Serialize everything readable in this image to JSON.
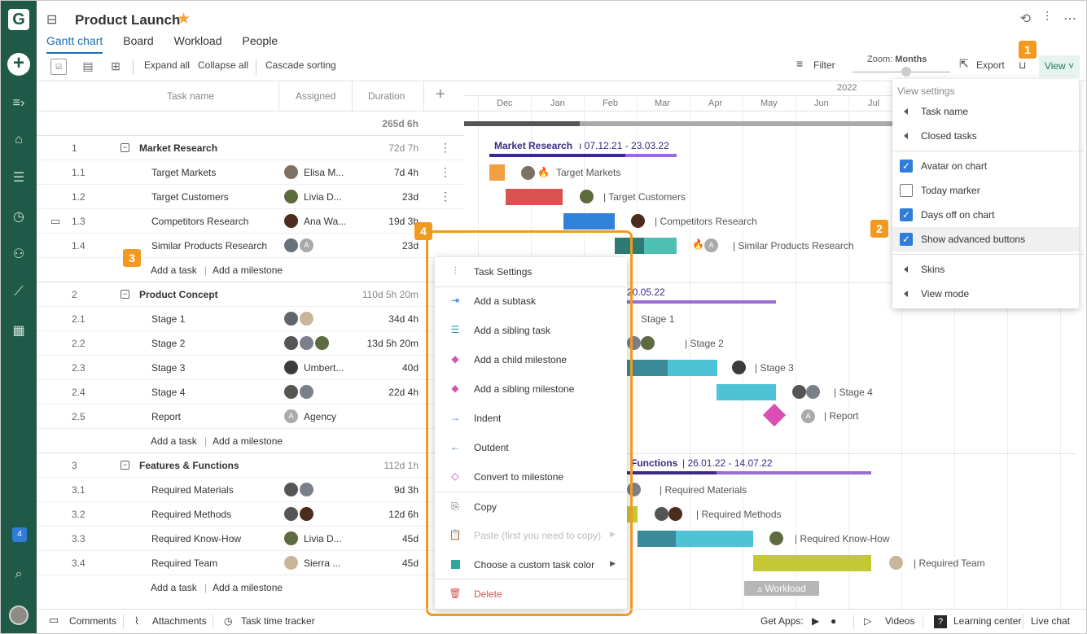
{
  "app": {
    "logo_letter": "G",
    "rail_notification_count": "4"
  },
  "header": {
    "title": "Product Launch",
    "tabs": [
      {
        "label": "Gantt chart"
      },
      {
        "label": "Board"
      },
      {
        "label": "Workload"
      },
      {
        "label": "People"
      }
    ]
  },
  "toolbar": {
    "expand_all": "Expand all",
    "collapse_all": "Collapse all",
    "cascade_sorting": "Cascade sorting",
    "filter": "Filter",
    "zoom_label": "Zoom:",
    "zoom_value": "Months",
    "export": "Export",
    "view": "View"
  },
  "grid": {
    "headers": {
      "task_name": "Task name",
      "assigned": "Assigned",
      "duration": "Duration"
    },
    "total_duration": "265d 6h",
    "rows": [
      {
        "num": "1",
        "name": "Market Research",
        "dur": "72d 7h",
        "group": true
      },
      {
        "num": "1.1",
        "name": "Target Markets",
        "assigned": "Elisa M...",
        "dur": "7d 4h"
      },
      {
        "num": "1.2",
        "name": "Target Customers",
        "assigned": "Livia D...",
        "dur": "23d"
      },
      {
        "num": "1.3",
        "name": "Competitors Research",
        "assigned": "Ana Wa...",
        "dur": "19d 3h"
      },
      {
        "num": "1.4",
        "name": "Similar Products Research",
        "assigned": "",
        "dur": "23d"
      },
      {
        "num": "2",
        "name": "Product Concept",
        "dur": "110d 5h 20m",
        "group": true
      },
      {
        "num": "2.1",
        "name": "Stage 1",
        "dur": "34d 4h"
      },
      {
        "num": "2.2",
        "name": "Stage 2",
        "dur": "13d 5h 20m"
      },
      {
        "num": "2.3",
        "name": "Stage 3",
        "assigned": "Umbert...",
        "dur": "40d"
      },
      {
        "num": "2.4",
        "name": "Stage 4",
        "dur": "22d 4h"
      },
      {
        "num": "2.5",
        "name": "Report",
        "assigned": "Agency",
        "dur": ""
      },
      {
        "num": "3",
        "name": "Features & Functions",
        "dur": "112d 1h",
        "group": true
      },
      {
        "num": "3.1",
        "name": "Required Materials",
        "dur": "9d 3h"
      },
      {
        "num": "3.2",
        "name": "Required Methods",
        "dur": "12d 6h"
      },
      {
        "num": "3.3",
        "name": "Required Know-How",
        "assigned": "Livia D...",
        "dur": "45d"
      },
      {
        "num": "3.4",
        "name": "Required Team",
        "assigned": "Sierra ...",
        "dur": "45d"
      }
    ],
    "add_task": "Add a task",
    "add_milestone": "Add a milestone",
    "avatar_initial": "A"
  },
  "chart": {
    "year": "2022",
    "months": [
      "Dec",
      "Jan",
      "Feb",
      "Mar",
      "Apr",
      "May",
      "Jun",
      "Jul"
    ],
    "group1_title": "Market Research",
    "group1_dates": "07.12.21 - 23.03.22",
    "group2_dates": "20.05.22",
    "group3_title": "Functions",
    "group3_dates": "26.01.22 - 14.07.22",
    "labels": [
      "Target Markets",
      "Target Customers",
      "Competitors Research",
      "Similar Products Research",
      "Stage 1",
      "Stage 2",
      "Stage 3",
      "Stage 4",
      "Report",
      "Required Materials",
      "Required Methods",
      "Required Know-How",
      "Required Team"
    ],
    "workload": "Workload"
  },
  "view_panel": {
    "header": "View settings",
    "items": [
      {
        "label": "Task name"
      },
      {
        "label": "Closed tasks"
      },
      {
        "label": "Avatar on chart",
        "checked": true
      },
      {
        "label": "Today marker",
        "checked": false
      },
      {
        "label": "Days off on chart",
        "checked": true
      },
      {
        "label": "Show advanced buttons",
        "checked": true
      },
      {
        "label": "Skins"
      },
      {
        "label": "View mode"
      }
    ]
  },
  "context_menu": {
    "items": [
      {
        "label": "Task Settings"
      },
      {
        "label": "Add a subtask"
      },
      {
        "label": "Add a sibling task"
      },
      {
        "label": "Add a child milestone"
      },
      {
        "label": "Add a sibling milestone"
      },
      {
        "label": "Indent"
      },
      {
        "label": "Outdent"
      },
      {
        "label": "Convert to milestone"
      },
      {
        "label": "Copy"
      },
      {
        "label": "Paste (first you need to copy)"
      },
      {
        "label": "Choose a custom task color"
      },
      {
        "label": "Delete"
      }
    ]
  },
  "callouts": [
    "1",
    "2",
    "3",
    "4"
  ],
  "footer": {
    "comments": "Comments",
    "attachments": "Attachments",
    "time_tracker": "Task time tracker",
    "get_apps": "Get Apps:",
    "videos": "Videos",
    "learning": "Learning center",
    "live_chat": "Live chat"
  },
  "colors": {
    "rail": "#1e5a47",
    "accent_blue": "#1b6fb0",
    "callout_orange": "#f29a1f",
    "checkbox_blue": "#2f7dd8",
    "group_bar_purple": "#9a6cd6"
  }
}
